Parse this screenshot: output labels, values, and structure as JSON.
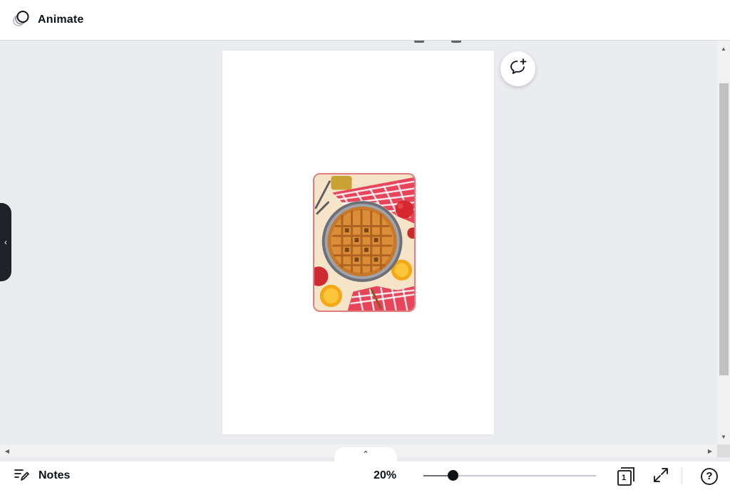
{
  "toolbar": {
    "animate_label": "Animate",
    "animate_icon": "animate-circles-icon"
  },
  "canvas": {
    "background_color": "#ebecf0",
    "page_color": "#ffffff",
    "image": {
      "icon": "apple-pie-photo",
      "border_color": "#e07c7c"
    },
    "comment_icon": "add-comment-icon"
  },
  "sidebar": {
    "collapse_icon": "chevron-left-icon",
    "collapse_glyph": "‹"
  },
  "pages_panel": {
    "toggle_glyph": "⌃"
  },
  "footer": {
    "notes_label": "Notes",
    "notes_icon": "notes-pencil-icon",
    "zoom_label": "20%",
    "zoom_fraction": 0.17,
    "page_number": "1",
    "page_icon": "pages-grid-icon",
    "fullscreen_icon": "expand-icon",
    "help_label": "?",
    "help_icon": "help-circle-icon"
  },
  "scrollbars": {
    "up_glyph": "▲",
    "down_glyph": "▼",
    "left_glyph": "◀",
    "right_glyph": "▶"
  }
}
